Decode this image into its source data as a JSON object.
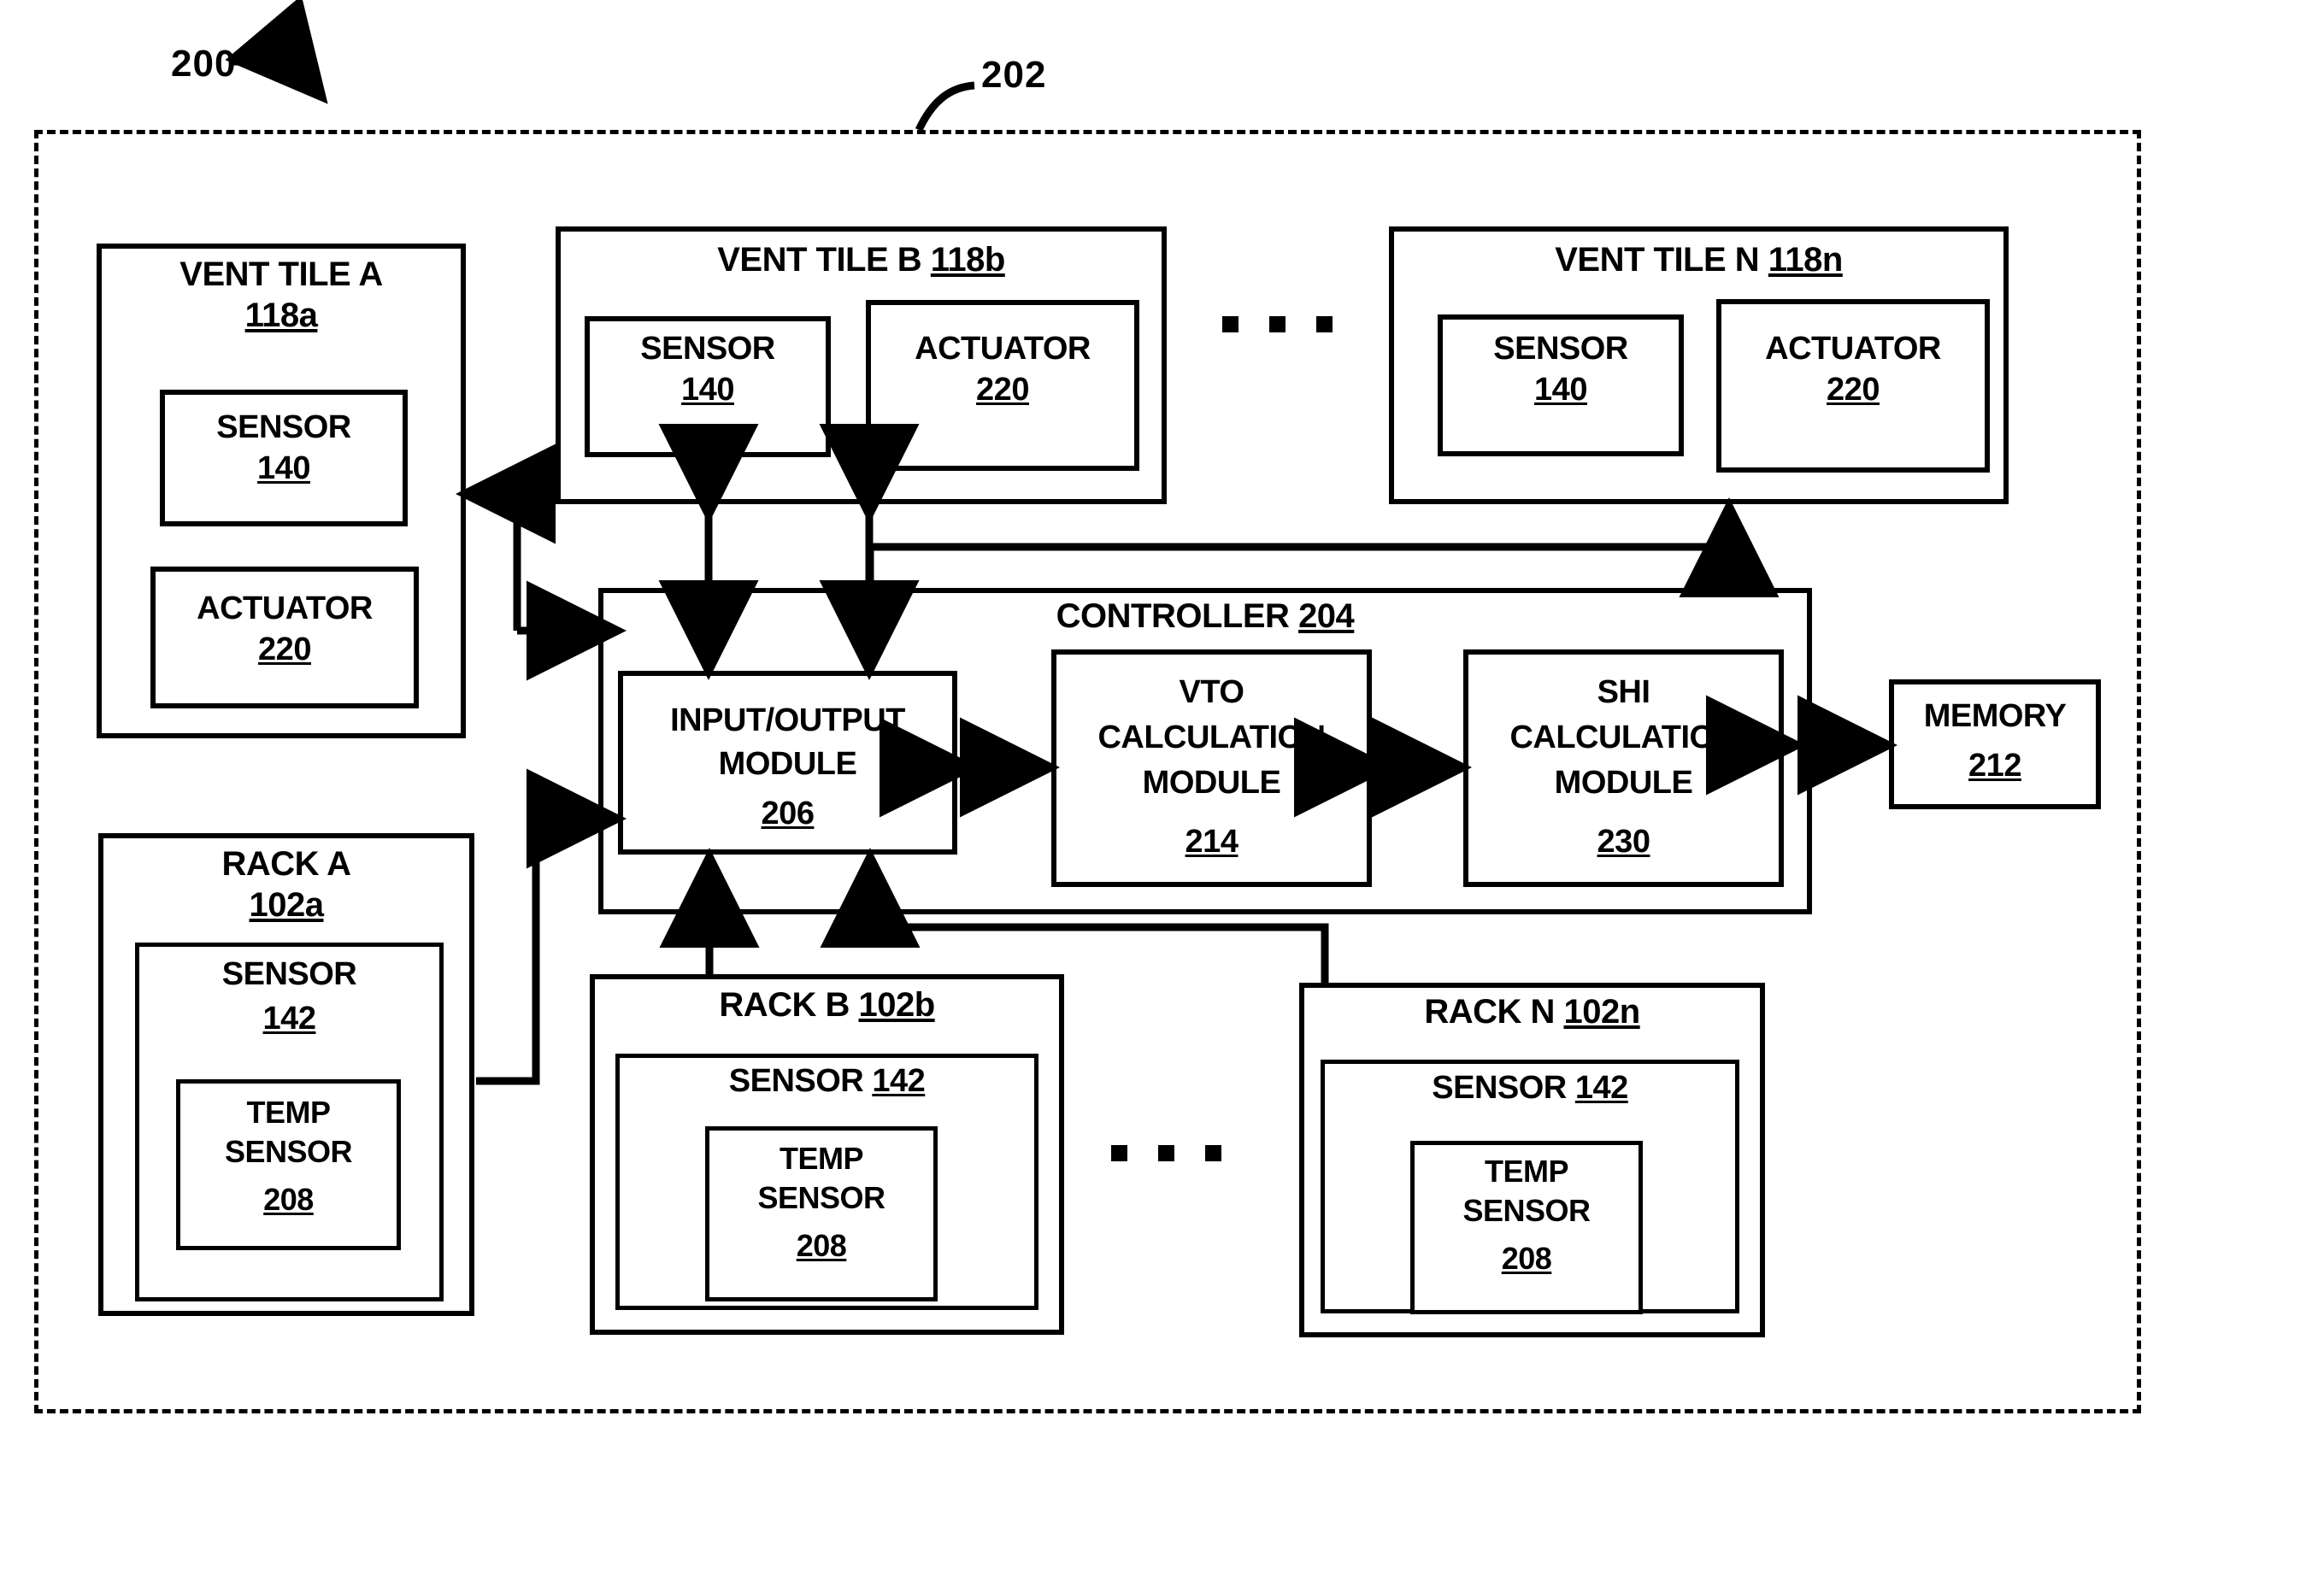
{
  "figure": {
    "ref_200": "200",
    "ref_202": "202"
  },
  "vent_tiles": [
    {
      "id": "vent-tile-a",
      "title_line1": "VENT TILE A",
      "title_line2": "118a",
      "sensor": {
        "name": "SENSOR",
        "num": "140"
      },
      "actuator": {
        "name": "ACTUATOR",
        "num": "220"
      }
    },
    {
      "id": "vent-tile-b",
      "title_line1": "VENT TILE B",
      "title_num": "118b",
      "sensor": {
        "name": "SENSOR",
        "num": "140"
      },
      "actuator": {
        "name": "ACTUATOR",
        "num": "220"
      }
    },
    {
      "id": "vent-tile-n",
      "title_line1": "VENT TILE N",
      "title_num": "118n",
      "sensor": {
        "name": "SENSOR",
        "num": "140"
      },
      "actuator": {
        "name": "ACTUATOR",
        "num": "220"
      }
    }
  ],
  "controller": {
    "title": "CONTROLLER",
    "num": "204",
    "io_module": {
      "line1": "INPUT/OUTPUT",
      "line2": "MODULE",
      "num": "206"
    },
    "vto_module": {
      "line1": "VTO",
      "line2": "CALCULATION",
      "line3": "MODULE",
      "num": "214"
    },
    "shi_module": {
      "line1": "SHI",
      "line2": "CALCULATION",
      "line3": "MODULE",
      "num": "230"
    }
  },
  "memory": {
    "name": "MEMORY",
    "num": "212"
  },
  "racks": [
    {
      "id": "rack-a",
      "title_line1": "RACK A",
      "title_line2": "102a",
      "sensor": {
        "name": "SENSOR",
        "num": "142"
      },
      "temp_sensor": {
        "line1": "TEMP",
        "line2": "SENSOR",
        "num": "208"
      }
    },
    {
      "id": "rack-b",
      "title_line1": "RACK B",
      "title_num": "102b",
      "sensor": {
        "name": "SENSOR",
        "num": "142"
      },
      "temp_sensor": {
        "line1": "TEMP",
        "line2": "SENSOR",
        "num": "208"
      }
    },
    {
      "id": "rack-n",
      "title_line1": "RACK N",
      "title_num": "102n",
      "sensor": {
        "name": "SENSOR",
        "num": "142"
      },
      "temp_sensor": {
        "line1": "TEMP",
        "line2": "SENSOR",
        "num": "208"
      }
    }
  ],
  "ellipsis": {
    "vent_tiles": "· · ·",
    "racks": "· · ·"
  },
  "colors": {
    "stroke": "#000000",
    "background": "#ffffff"
  }
}
